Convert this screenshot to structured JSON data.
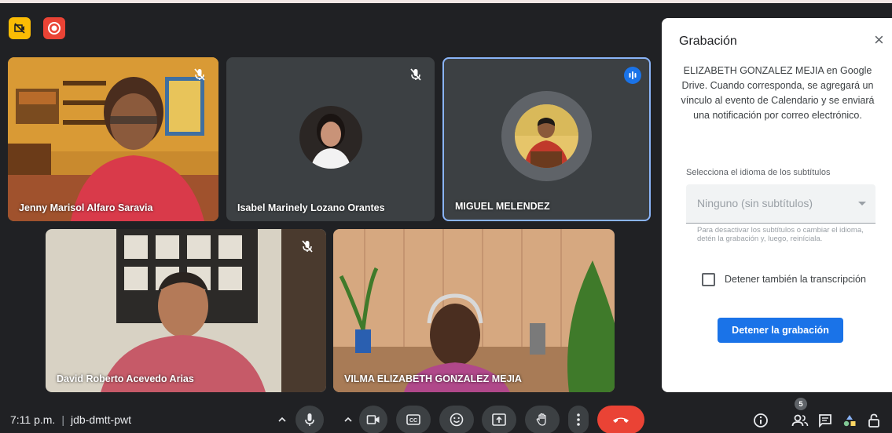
{
  "participants": [
    {
      "name": "Jenny Marisol Alfaro Saravia",
      "muted": true
    },
    {
      "name": "Isabel Marinely Lozano Orantes",
      "muted": true
    },
    {
      "name": "MIGUEL MELENDEZ",
      "muted": false,
      "speaking": true
    },
    {
      "name": "David Roberto Acevedo Arias",
      "muted": true
    },
    {
      "name": "VILMA ELIZABETH GONZALEZ MEJIA",
      "muted": false
    }
  ],
  "recording_panel": {
    "title": "Grabación",
    "description": "ELIZABETH GONZALEZ MEJIA en Google Drive. Cuando corresponda, se agregará un vínculo al evento de Calendario y se enviará una notificación por correo electrónico.",
    "subtitle_label": "Selecciona el idioma de los subtítulos",
    "subtitle_value": "Ninguno (sin subtítulos)",
    "help_text": "Para desactivar los subtítulos o cambiar el idioma, detén la grabación y, luego, reiníciala.",
    "checkbox_label": "Detener también la transcripción",
    "checkbox_checked": false,
    "stop_button": "Detener la grabación",
    "close_symbol": "×"
  },
  "meeting": {
    "time": "7:11 p.m.",
    "separator": "|",
    "code": "jdb-dmtt-pwt",
    "participant_count": "5"
  },
  "colors": {
    "background": "#202124",
    "accent": "#1a73e8",
    "end_call": "#ea4335",
    "recording_badge": "#ea4335",
    "indicator_badge": "#fbbc04"
  }
}
